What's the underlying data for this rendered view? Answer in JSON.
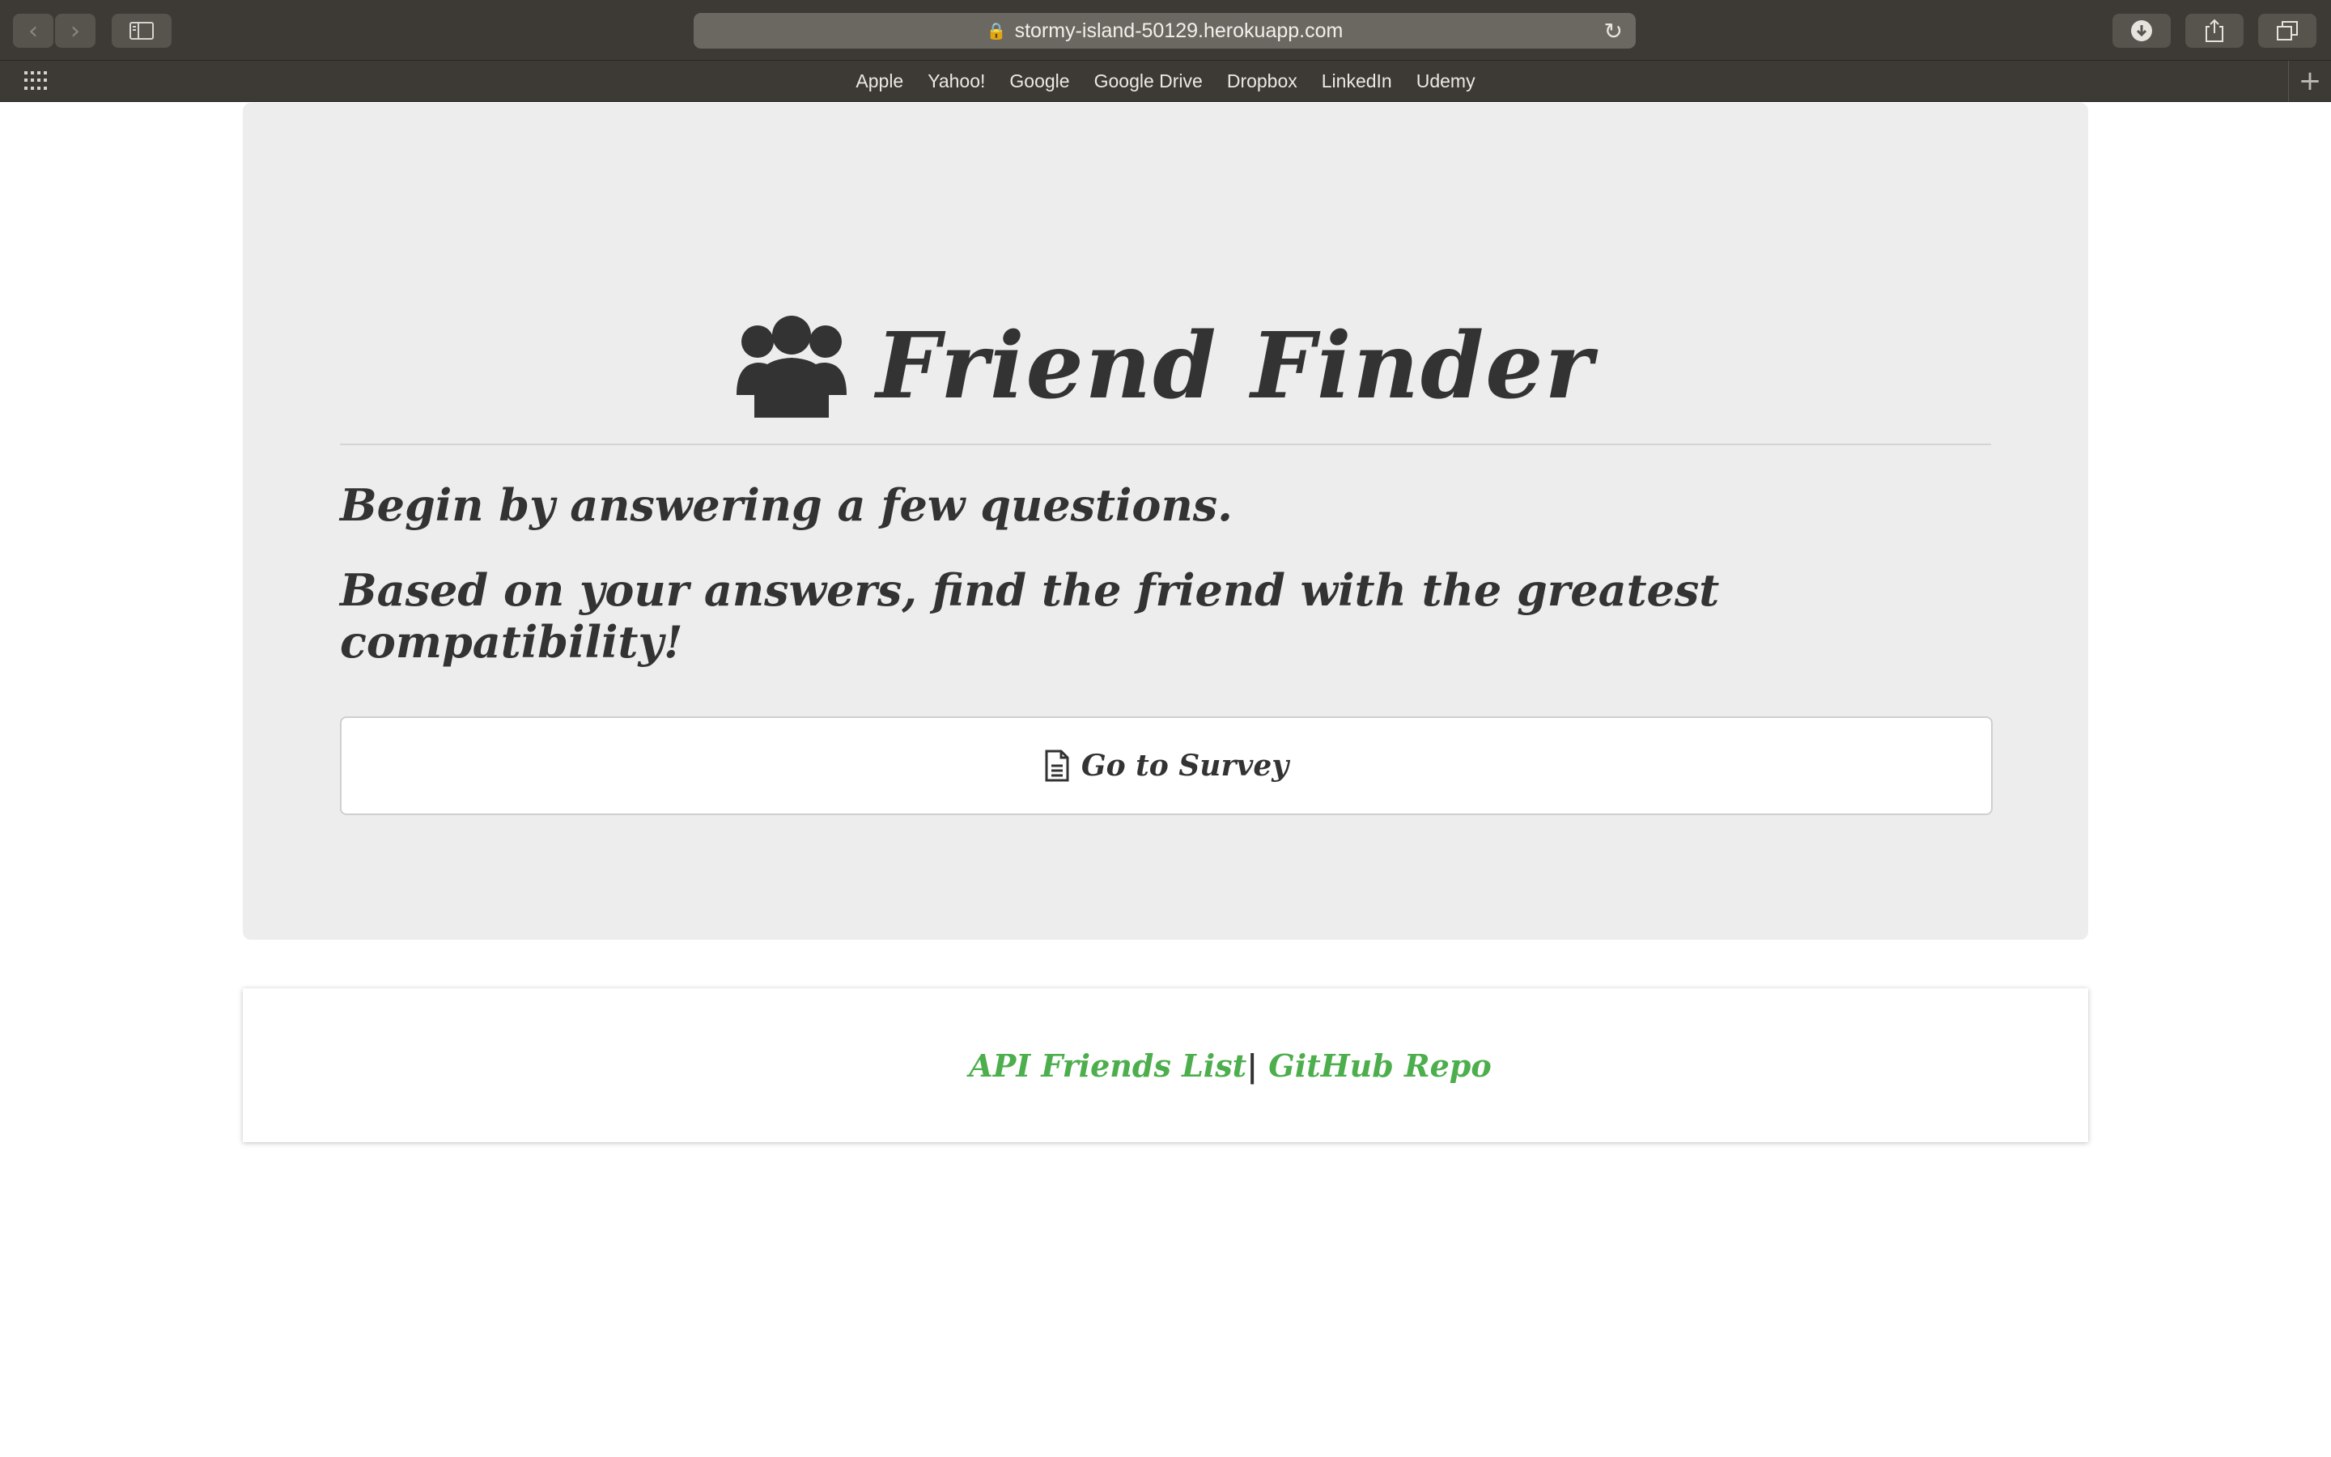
{
  "browser": {
    "url": "stormy-island-50129.herokuapp.com",
    "favorites": [
      "Apple",
      "Yahoo!",
      "Google",
      "Google Drive",
      "Dropbox",
      "LinkedIn",
      "Udemy"
    ]
  },
  "page": {
    "title": "Friend Finder",
    "title_icon": "users-icon",
    "lead_1": "Begin by answering a few questions.",
    "lead_2": "Based on your answers, find the friend with the greatest compatibility!",
    "survey_button_label": "Go to Survey",
    "survey_button_icon": "file-text-icon"
  },
  "footer": {
    "api_link": "API Friends List",
    "separator": "|",
    "github_link": "GitHub Repo"
  },
  "colors": {
    "jumbotron_bg": "#ededed",
    "text": "#333333",
    "link": "#4cae4c",
    "chrome": "#3d3a35"
  }
}
